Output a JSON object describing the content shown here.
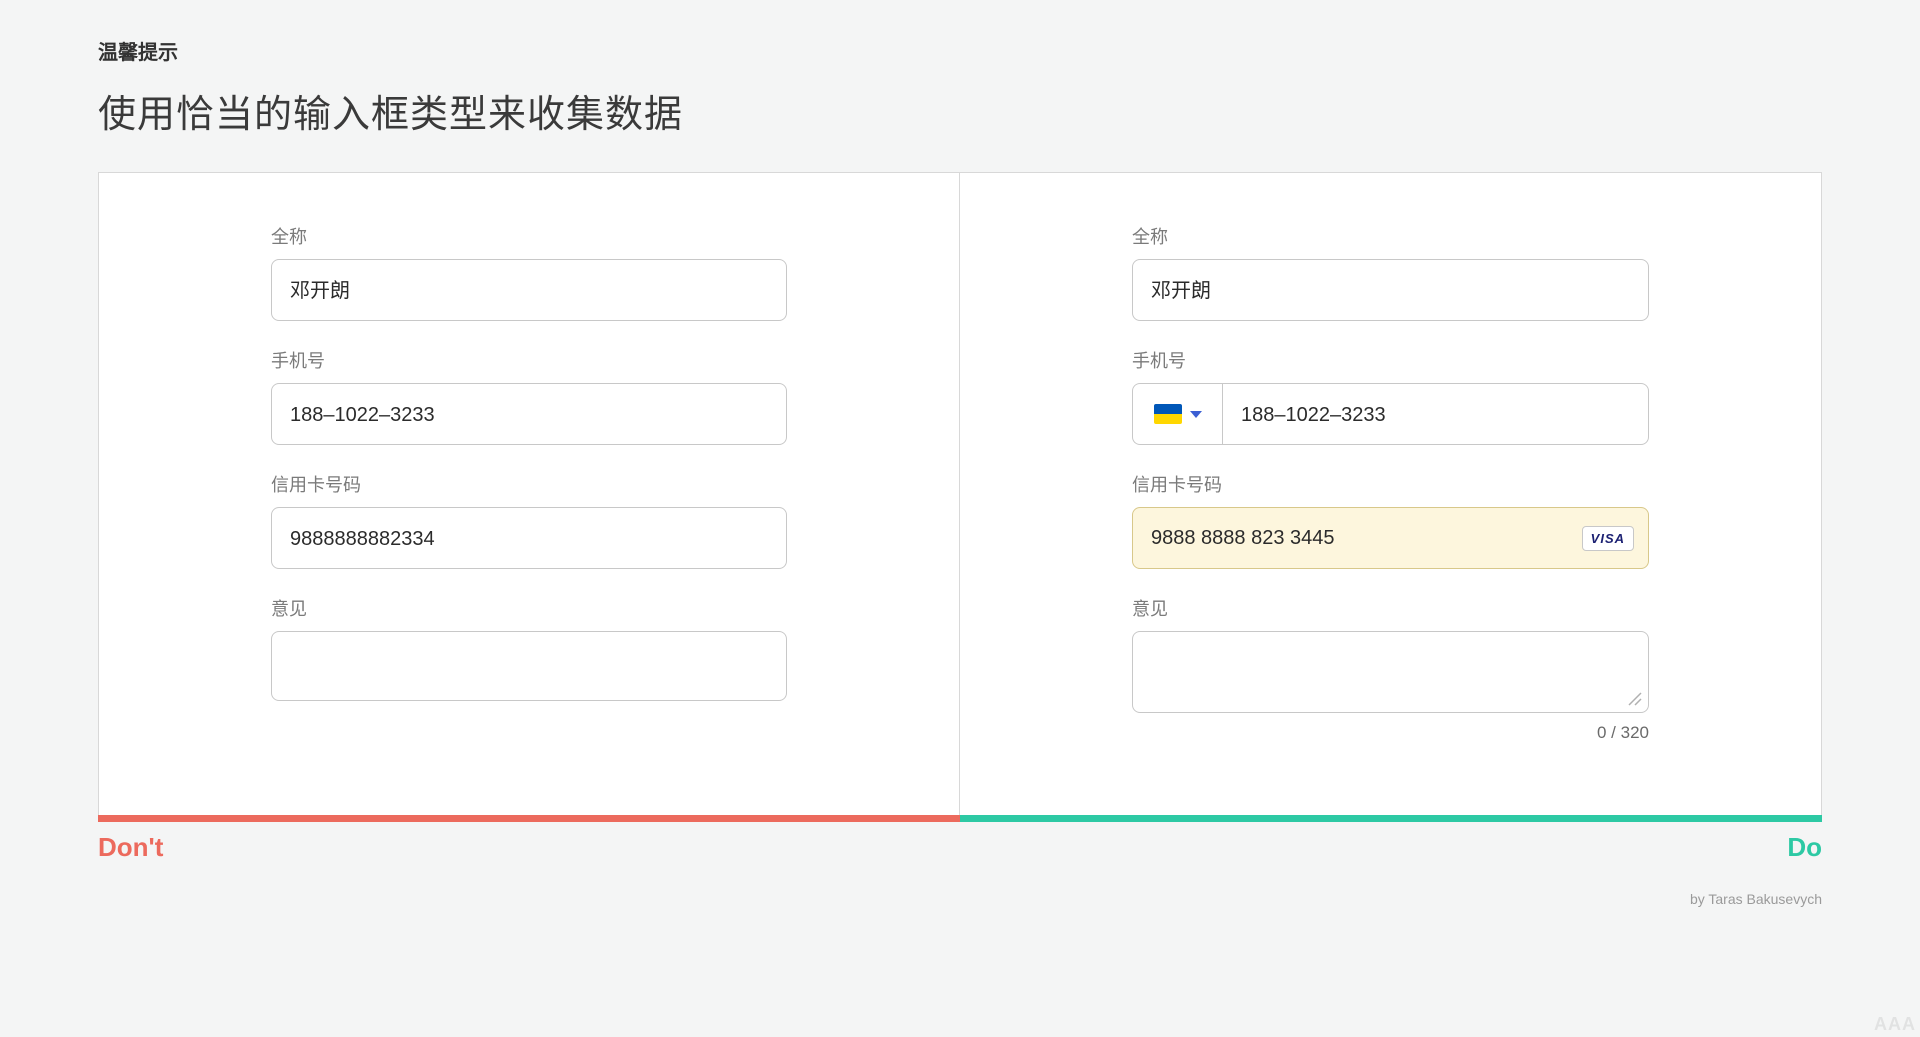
{
  "header": {
    "tip_label": "温馨提示",
    "title": "使用恰当的输入框类型来收集数据"
  },
  "colors": {
    "dont": "#ec6a5d",
    "do": "#2dc9a4"
  },
  "left": {
    "fullname_label": "全称",
    "fullname_value": "邓开朗",
    "phone_label": "手机号",
    "phone_value": "188–1022–3233",
    "cc_label": "信用卡号码",
    "cc_value": "9888888882334",
    "opinion_label": "意见"
  },
  "right": {
    "fullname_label": "全称",
    "fullname_value": "邓开朗",
    "phone_label": "手机号",
    "phone_value": "188–1022–3233",
    "phone_country_flag": "ukraine",
    "cc_label": "信用卡号码",
    "cc_value": "9888 8888 823 3445",
    "cc_brand": "VISA",
    "opinion_label": "意见",
    "char_counter": "0 / 320"
  },
  "footer": {
    "dont_label": "Don't",
    "do_label": "Do",
    "credit": "by Taras Bakusevych",
    "watermark": "AAA"
  }
}
